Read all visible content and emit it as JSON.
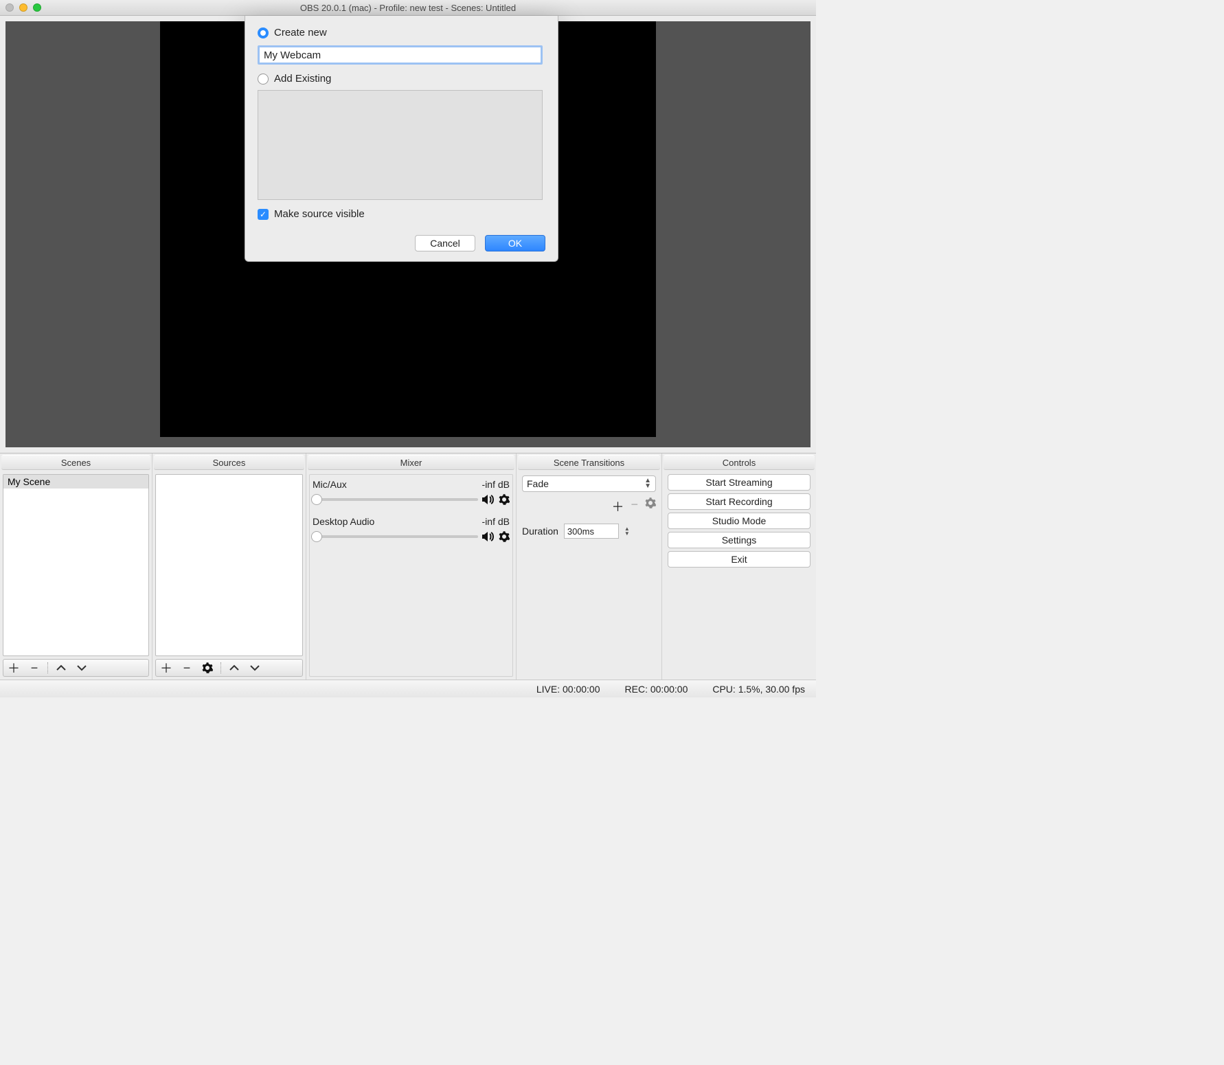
{
  "titlebar": {
    "title": "OBS 20.0.1 (mac) - Profile: new test - Scenes: Untitled"
  },
  "panels": {
    "scenes": {
      "header": "Scenes",
      "items": [
        "My Scene"
      ]
    },
    "sources": {
      "header": "Sources"
    },
    "mixer": {
      "header": "Mixer",
      "channels": [
        {
          "name": "Mic/Aux",
          "level": "-inf dB"
        },
        {
          "name": "Desktop Audio",
          "level": "-inf dB"
        }
      ]
    },
    "transitions": {
      "header": "Scene Transitions",
      "selected": "Fade",
      "duration_label": "Duration",
      "duration_value": "300ms"
    },
    "controls": {
      "header": "Controls",
      "buttons": [
        "Start Streaming",
        "Start Recording",
        "Studio Mode",
        "Settings",
        "Exit"
      ]
    }
  },
  "status": {
    "live": "LIVE: 00:00:00",
    "rec": "REC: 00:00:00",
    "cpu": "CPU: 1.5%, 30.00 fps"
  },
  "dialog": {
    "create_new": "Create new",
    "name_value": "My Webcam",
    "add_existing": "Add Existing",
    "make_visible": "Make source visible",
    "cancel": "Cancel",
    "ok": "OK"
  }
}
